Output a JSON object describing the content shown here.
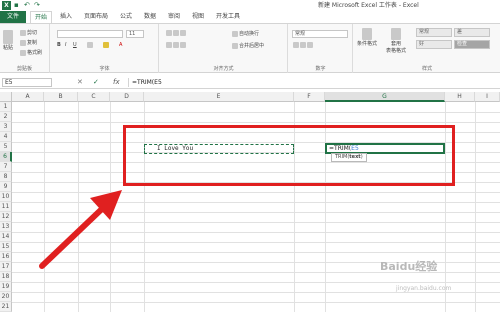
{
  "title_bar": {
    "app_logo": "X",
    "window_title": "新建 Microsoft Excel 工作表 - Excel"
  },
  "ribbon_tabs": [
    {
      "label": "文件"
    },
    {
      "label": "开始"
    },
    {
      "label": "插入"
    },
    {
      "label": "页面布局"
    },
    {
      "label": "公式"
    },
    {
      "label": "数据"
    },
    {
      "label": "审阅"
    },
    {
      "label": "视图"
    },
    {
      "label": "开发工具"
    }
  ],
  "ribbon": {
    "clipboard": {
      "paste": "粘贴",
      "cut": "剪切",
      "copy": "复制",
      "format_painter": "格式刷",
      "group_label": "剪贴板"
    },
    "font": {
      "font_name": "",
      "font_size": "11",
      "group_label": "字体"
    },
    "alignment": {
      "wrap": "自动换行",
      "merge": "合并后居中",
      "group_label": "对齐方式"
    },
    "number": {
      "format": "常规",
      "group_label": "数字"
    },
    "styles": {
      "conditional": "条件格式",
      "table": "套用\n表格格式",
      "normal": "常规",
      "bad": "差",
      "good": "好",
      "check": "检查",
      "group_label": "样式"
    }
  },
  "formula_bar": {
    "name_box": "E5",
    "cancel": "✕",
    "enter": "✓",
    "fx": "fx",
    "formula": "=TRIM(E5"
  },
  "sheet": {
    "columns": [
      "A",
      "B",
      "C",
      "D",
      "E",
      "F",
      "G",
      "H",
      "I"
    ],
    "selected_column": "G",
    "rows": [
      "1",
      "2",
      "3",
      "4",
      "5",
      "6",
      "7",
      "8",
      "9",
      "10",
      "11",
      "12",
      "13",
      "14",
      "15",
      "16",
      "17",
      "18",
      "19",
      "20",
      "21"
    ],
    "selected_row": "6",
    "cell_e6": "I Love You",
    "cell_g6_prefix": "=TRIM(",
    "cell_g6_ref": "E5",
    "tooltip_fn": "TRIM(",
    "tooltip_arg": "text",
    "tooltip_end": ")"
  },
  "annotation": {
    "box_color": "#e02020",
    "arrow_color": "#e02020"
  },
  "watermark": {
    "text": "Baidu经验",
    "sub": "jingyan.baidu.com"
  }
}
